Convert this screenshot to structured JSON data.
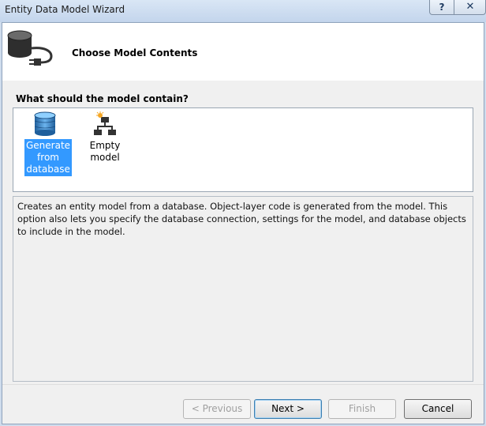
{
  "window": {
    "title": "Entity Data Model Wizard",
    "help_label": "?",
    "close_label": "✕"
  },
  "header": {
    "title": "Choose Model Contents",
    "icon": "database-plug-icon"
  },
  "main": {
    "question": "What should the model contain?",
    "items": [
      {
        "label_lines": [
          "Generate",
          "from",
          "database"
        ],
        "icon": "database-icon",
        "selected": true
      },
      {
        "label_lines": [
          "Empty model"
        ],
        "icon": "hierarchy-icon",
        "selected": false
      }
    ],
    "description": "Creates an entity model from a database. Object-layer code is generated from the model. This option also lets you specify the database connection, settings for the model, and database objects to include in the model."
  },
  "footer": {
    "previous_label": "< Previous",
    "next_label": "Next >",
    "finish_label": "Finish",
    "cancel_label": "Cancel"
  },
  "colors": {
    "selection": "#3399ff",
    "header_bg": "#ffffff",
    "dialog_bg": "#f0f0f0"
  }
}
